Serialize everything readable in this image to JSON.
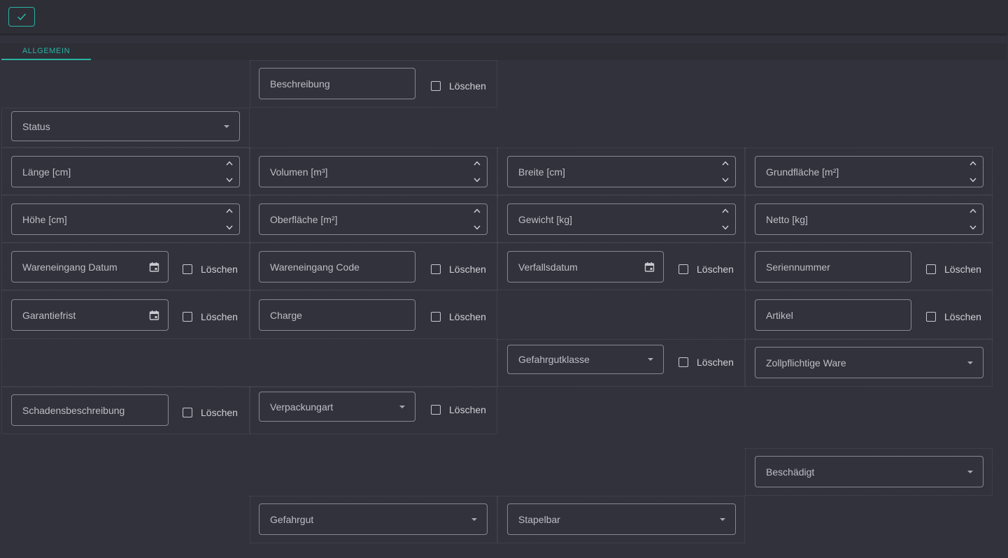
{
  "toolbar": {
    "save_icon": "check-icon",
    "accent": "#2ab3a2"
  },
  "tabs": [
    {
      "label": "ALLGEMEIN",
      "active": true
    }
  ],
  "delete_label": "Löschen",
  "fields": {
    "beschreibung": "Beschreibung",
    "status": "Status",
    "laenge": "Länge [cm]",
    "volumen": "Volumen [m³]",
    "breite": "Breite [cm]",
    "grundflaeche": "Grundfläche [m²]",
    "hoehe": "Höhe [cm]",
    "oberflaeche": "Oberfläche [m²]",
    "gewicht": "Gewicht [kg]",
    "netto": "Netto [kg]",
    "wareneingang_datum": "Wareneingang Datum",
    "wareneingang_code": "Wareneingang Code",
    "verfallsdatum": "Verfallsdatum",
    "seriennummer": "Seriennummer",
    "garantiefrist": "Garantiefrist",
    "charge": "Charge",
    "artikel": "Artikel",
    "gefahrgutklasse": "Gefahrgutklasse",
    "zollpflichtige_ware": "Zollpflichtige Ware",
    "schadensbeschreibung": "Schadensbeschreibung",
    "verpackungart": "Verpackungart",
    "beschaedigt": "Beschädigt",
    "gefahrgut": "Gefahrgut",
    "stapelbar": "Stapelbar"
  }
}
